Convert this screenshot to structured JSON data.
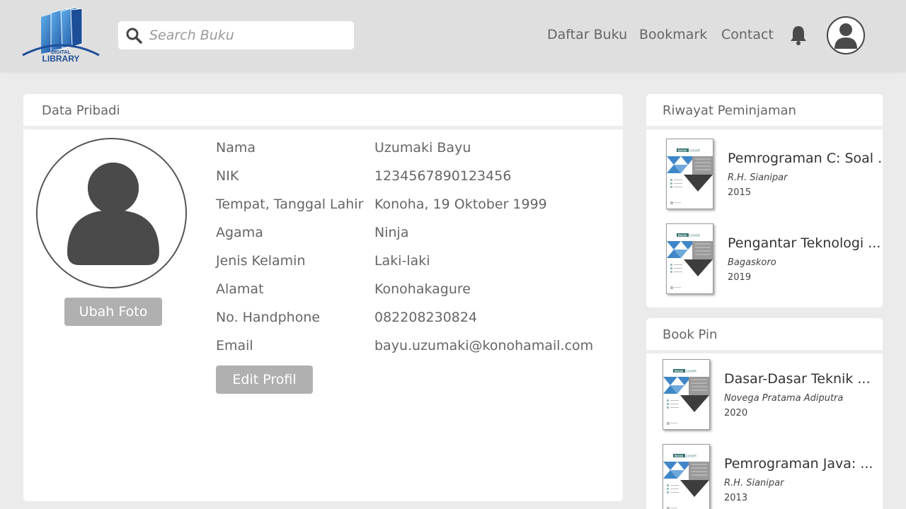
{
  "header": {
    "logo_top": "DIGITAL",
    "logo_bottom": "LIBRARY",
    "search_placeholder": "Search Buku",
    "nav": [
      "Daftar Buku",
      "Bookmark",
      "Contact"
    ],
    "icons": {
      "search": "search-icon",
      "bell": "bell-icon",
      "user": "user-avatar-icon"
    }
  },
  "profile": {
    "title": "Data Pribadi",
    "change_photo_label": "Ubah Foto",
    "edit_label": "Edit Profil",
    "fields": [
      {
        "label": "Nama",
        "value": "Uzumaki Bayu"
      },
      {
        "label": "NIK",
        "value": "1234567890123456"
      },
      {
        "label": "Tempat, Tanggal Lahir",
        "value": "Konoha, 19 Oktober 1999"
      },
      {
        "label": "Agama",
        "value": "Ninja"
      },
      {
        "label": "Jenis Kelamin",
        "value": "Laki-laki"
      },
      {
        "label": "Alamat",
        "value": "Konohakagure"
      },
      {
        "label": "No. Handphone",
        "value": "082208230824"
      },
      {
        "label": "Email",
        "value": "bayu.uzumaki@konohamail.com"
      }
    ]
  },
  "history": {
    "title": "Riwayat Peminjaman",
    "books": [
      {
        "title": "Pemrograman C: Soal ...",
        "author": "R.H. Sianipar",
        "year": "2015"
      },
      {
        "title": "Pengantar Teknologi ...",
        "author": "Bagaskoro",
        "year": "2019"
      }
    ]
  },
  "pins": {
    "title": "Book Pin",
    "books": [
      {
        "title": "Dasar-Dasar Teknik ...",
        "author": "Novega Pratama Adiputra",
        "year": "2020"
      },
      {
        "title": "Pemrograman Java: ...",
        "author": "R.H. Sianipar",
        "year": "2013"
      }
    ]
  },
  "cover_text": {
    "badge": "BOOK",
    "word": "COVER"
  },
  "colors": {
    "header_bg": "#dfdfdf",
    "page_bg": "#ebebeb",
    "button_gray": "#b0b0b0",
    "cover_blue": "#3f86c8",
    "dark_icon": "#4a4a4a"
  }
}
